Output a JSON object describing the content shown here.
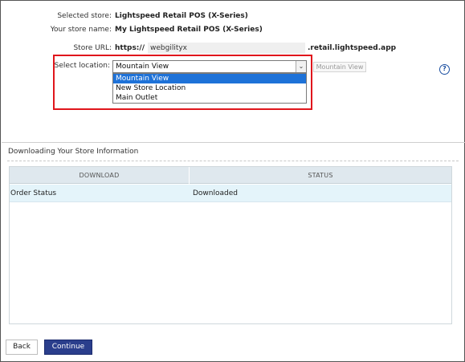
{
  "store": {
    "selected_store_label": "Selected store:",
    "selected_store_value": "Lightspeed Retail POS (X-Series)",
    "store_name_label": "Your store name:",
    "store_name_value": "My Lightspeed Retail POS (X-Series)",
    "url_label": "Store URL:",
    "url_prefix": "https://",
    "url_value": "webgilityx",
    "url_suffix": ".retail.lightspeed.app"
  },
  "location": {
    "label": "Select location:",
    "selected": "Mountain View",
    "options": [
      "Mountain View",
      "New Store Location",
      "Main Outlet"
    ],
    "side_button": "Mountain View"
  },
  "help_icon": "?",
  "download_section": {
    "title": "Downloading Your Store Information",
    "columns": [
      "DOWNLOAD",
      "STATUS"
    ],
    "rows": [
      {
        "download": "Order Status",
        "status": "Downloaded"
      }
    ]
  },
  "footer": {
    "back_label": "Back",
    "continue_label": "Continue"
  },
  "colors": {
    "highlight_border": "#e0161c",
    "selected_option": "#1e72d8",
    "primary_button": "#2a3e8c",
    "header_bg": "#dfe8ee",
    "row_bg": "#e4f4fa"
  }
}
